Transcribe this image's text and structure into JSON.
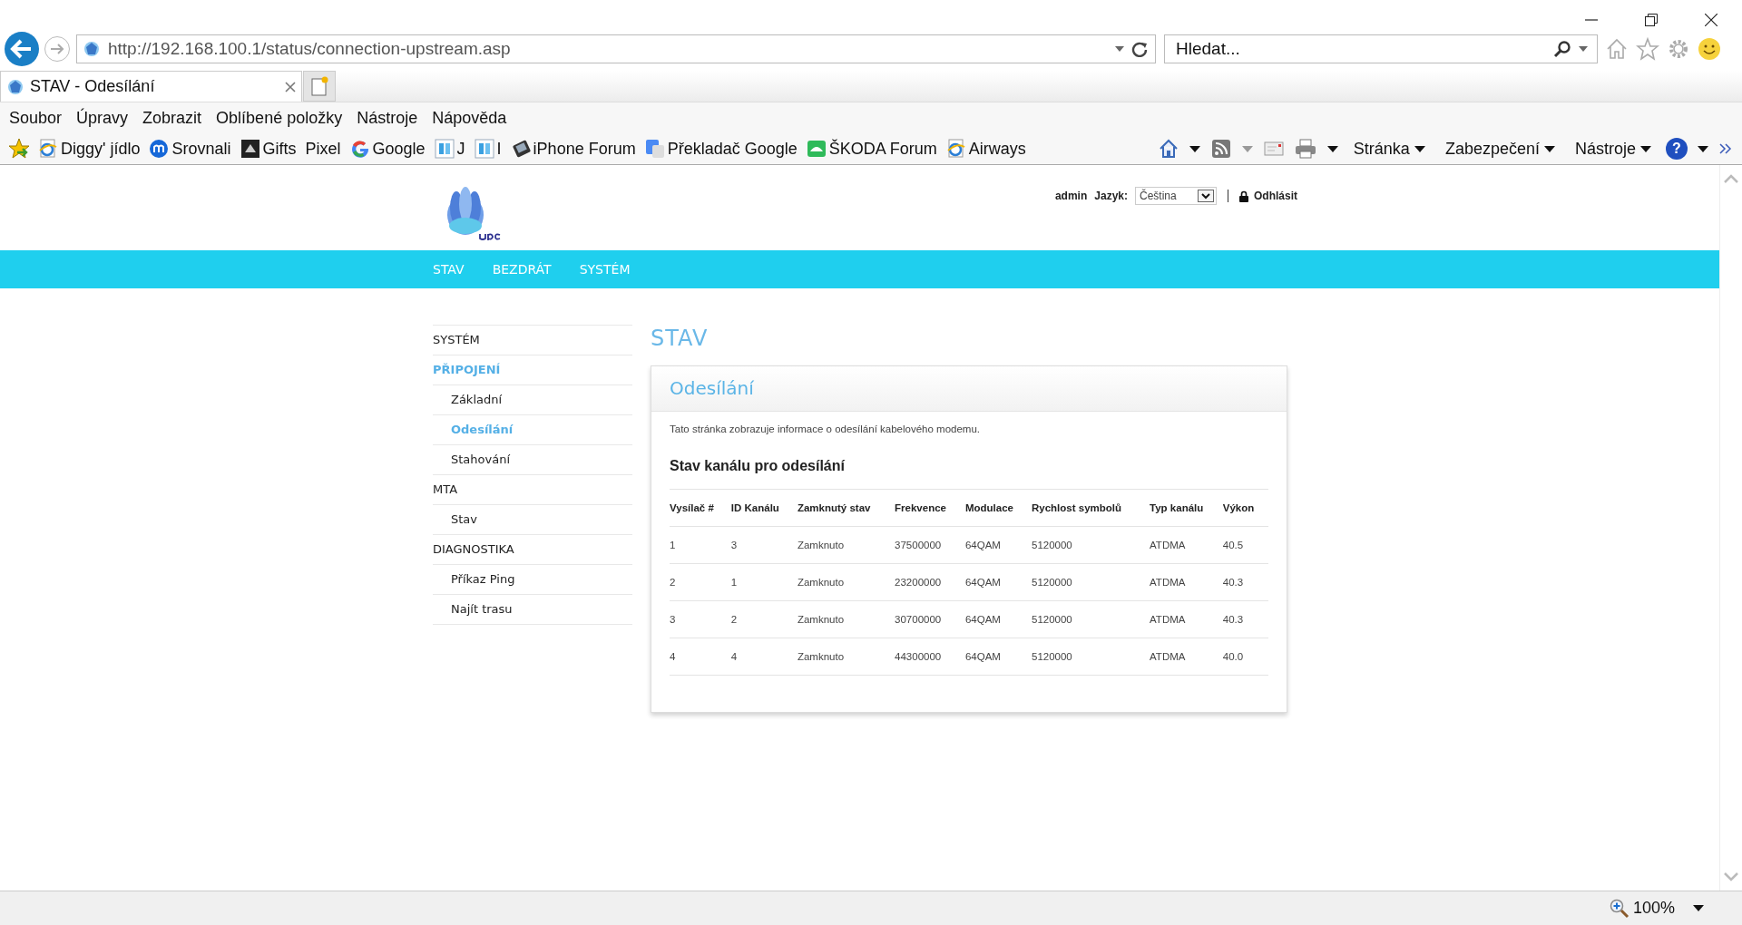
{
  "browser": {
    "address": "http://192.168.100.1/status/connection-upstream.asp",
    "search": {
      "placeholder": "Hledat..."
    },
    "tabs": [
      {
        "title": "STAV - Odesílání",
        "selected": true
      }
    ],
    "menu": [
      "Soubor",
      "Úpravy",
      "Zobrazit",
      "Oblíbené položky",
      "Nástroje",
      "Nápověda"
    ],
    "favorites": [
      {
        "label": "Diggy' jídlo",
        "kind": "ie"
      },
      {
        "label": "Srovnali",
        "kind": "circle"
      },
      {
        "label": "Gifts",
        "kind": "dark"
      },
      {
        "label": "Pixel",
        "kind": "none"
      },
      {
        "label": "Google",
        "kind": "google"
      },
      {
        "label": "J",
        "kind": "page"
      },
      {
        "label": "I",
        "kind": "page"
      },
      {
        "label": "iPhone Forum",
        "kind": "phone"
      },
      {
        "label": "Překladač Google",
        "kind": "translate"
      },
      {
        "label": "ŠKODA Forum",
        "kind": "green"
      },
      {
        "label": "Airways",
        "kind": "ie"
      }
    ],
    "commands": [
      "Stránka",
      "Zabezpečení",
      "Nástroje"
    ],
    "help": "?",
    "zoom": "100%"
  },
  "page": {
    "user": "admin",
    "language_label": "Jazyk:",
    "language": "Čeština",
    "logout": "Odhlásit",
    "nav": [
      "STAV",
      "BEZDRÁT",
      "SYSTÉM"
    ],
    "sidebar": [
      {
        "label": "SYSTÉM",
        "selected": false
      },
      {
        "label": "PŘIPOJENÍ",
        "selected": true,
        "children": [
          {
            "label": "Základní",
            "selected": false
          },
          {
            "label": "Odesílání",
            "selected": true
          },
          {
            "label": "Stahování",
            "selected": false
          }
        ]
      },
      {
        "label": "MTA",
        "selected": false,
        "children": [
          {
            "label": "Stav",
            "selected": false
          }
        ]
      },
      {
        "label": "DIAGNOSTIKA",
        "selected": false,
        "children": [
          {
            "label": "Příkaz Ping",
            "selected": false
          },
          {
            "label": "Najít trasu",
            "selected": false
          }
        ]
      }
    ],
    "heading": "STAV",
    "card": {
      "title": "Odesílání",
      "description": "Tato stránka zobrazuje informace o odesílání kabelového modemu.",
      "subheading": "Stav kanálu pro odesílání",
      "table": {
        "columns": [
          "Vysílač #",
          "ID Kanálu",
          "Zamknutý stav",
          "Frekvence",
          "Modulace",
          "Rychlost symbolů",
          "Typ kanálu",
          "Výkon"
        ],
        "rows": [
          [
            "1",
            "3",
            "Zamknuto",
            "37500000",
            "64QAM",
            "5120000",
            "ATDMA",
            "40.5"
          ],
          [
            "2",
            "1",
            "Zamknuto",
            "23200000",
            "64QAM",
            "5120000",
            "ATDMA",
            "40.3"
          ],
          [
            "3",
            "2",
            "Zamknuto",
            "30700000",
            "64QAM",
            "5120000",
            "ATDMA",
            "40.3"
          ],
          [
            "4",
            "4",
            "Zamknuto",
            "44300000",
            "64QAM",
            "5120000",
            "ATDMA",
            "40.0"
          ]
        ]
      }
    }
  }
}
